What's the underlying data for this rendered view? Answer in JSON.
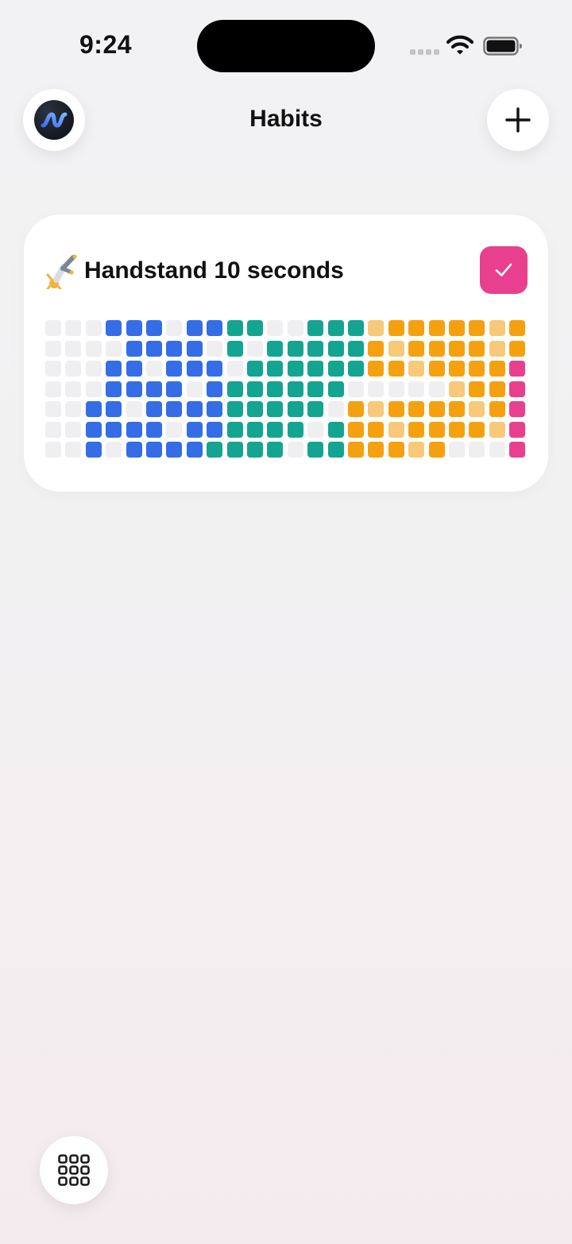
{
  "status_bar": {
    "time": "9:24"
  },
  "header": {
    "title": "Habits",
    "logo_icon": "wave-logo-icon",
    "add_icon": "plus-icon"
  },
  "habit": {
    "emoji": "🤸",
    "emoji_icon": "person-cartwheeling-icon",
    "name": "Handstand 10 seconds",
    "checked_today": true,
    "check_color": "#e8408e",
    "legend_colors": {
      "E": "#efeff1",
      "B": "#356de6",
      "T": "#13a591",
      "O": "#f5a10f",
      "L": "#f7c978",
      "P": "#e8408e"
    },
    "grid_rows": [
      "EEEBBBEBBTTEETTTLOOOOOLO",
      "EEEEBBBBETETTTTTOLOOOOLO",
      "EEEBBEBBBETTTTTTOOLOOOOP",
      "EEEBBBBEBTTTTTTEEEEELOOP",
      "EEBBEBBBBTTTTTEOLOOOOLOP",
      "EEBBBBEBBTTTTETOOLOOOOLP",
      "EEBEBBBBTTTTETTOOOLOEEEP"
    ]
  },
  "bottom": {
    "grid_button_icon": "grid-icon"
  }
}
